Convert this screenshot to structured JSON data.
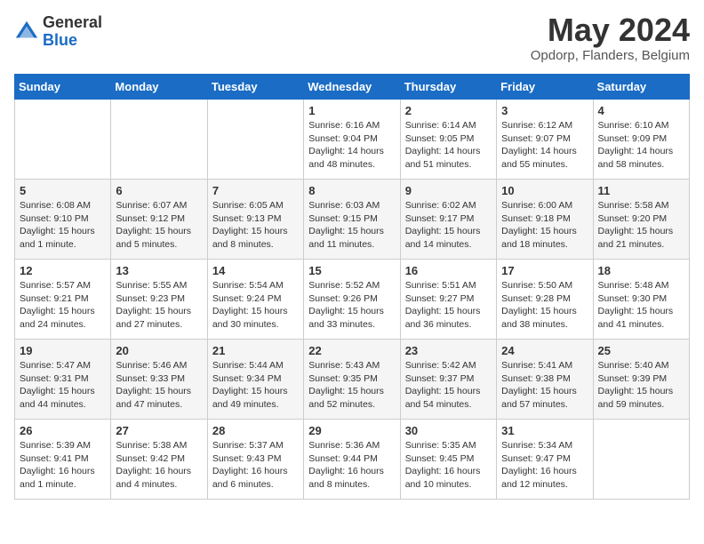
{
  "header": {
    "logo_line1": "General",
    "logo_line2": "Blue",
    "month_title": "May 2024",
    "location": "Opdorp, Flanders, Belgium"
  },
  "days_of_week": [
    "Sunday",
    "Monday",
    "Tuesday",
    "Wednesday",
    "Thursday",
    "Friday",
    "Saturday"
  ],
  "weeks": [
    [
      {
        "day": "",
        "info": ""
      },
      {
        "day": "",
        "info": ""
      },
      {
        "day": "",
        "info": ""
      },
      {
        "day": "1",
        "info": "Sunrise: 6:16 AM\nSunset: 9:04 PM\nDaylight: 14 hours\nand 48 minutes."
      },
      {
        "day": "2",
        "info": "Sunrise: 6:14 AM\nSunset: 9:05 PM\nDaylight: 14 hours\nand 51 minutes."
      },
      {
        "day": "3",
        "info": "Sunrise: 6:12 AM\nSunset: 9:07 PM\nDaylight: 14 hours\nand 55 minutes."
      },
      {
        "day": "4",
        "info": "Sunrise: 6:10 AM\nSunset: 9:09 PM\nDaylight: 14 hours\nand 58 minutes."
      }
    ],
    [
      {
        "day": "5",
        "info": "Sunrise: 6:08 AM\nSunset: 9:10 PM\nDaylight: 15 hours\nand 1 minute."
      },
      {
        "day": "6",
        "info": "Sunrise: 6:07 AM\nSunset: 9:12 PM\nDaylight: 15 hours\nand 5 minutes."
      },
      {
        "day": "7",
        "info": "Sunrise: 6:05 AM\nSunset: 9:13 PM\nDaylight: 15 hours\nand 8 minutes."
      },
      {
        "day": "8",
        "info": "Sunrise: 6:03 AM\nSunset: 9:15 PM\nDaylight: 15 hours\nand 11 minutes."
      },
      {
        "day": "9",
        "info": "Sunrise: 6:02 AM\nSunset: 9:17 PM\nDaylight: 15 hours\nand 14 minutes."
      },
      {
        "day": "10",
        "info": "Sunrise: 6:00 AM\nSunset: 9:18 PM\nDaylight: 15 hours\nand 18 minutes."
      },
      {
        "day": "11",
        "info": "Sunrise: 5:58 AM\nSunset: 9:20 PM\nDaylight: 15 hours\nand 21 minutes."
      }
    ],
    [
      {
        "day": "12",
        "info": "Sunrise: 5:57 AM\nSunset: 9:21 PM\nDaylight: 15 hours\nand 24 minutes."
      },
      {
        "day": "13",
        "info": "Sunrise: 5:55 AM\nSunset: 9:23 PM\nDaylight: 15 hours\nand 27 minutes."
      },
      {
        "day": "14",
        "info": "Sunrise: 5:54 AM\nSunset: 9:24 PM\nDaylight: 15 hours\nand 30 minutes."
      },
      {
        "day": "15",
        "info": "Sunrise: 5:52 AM\nSunset: 9:26 PM\nDaylight: 15 hours\nand 33 minutes."
      },
      {
        "day": "16",
        "info": "Sunrise: 5:51 AM\nSunset: 9:27 PM\nDaylight: 15 hours\nand 36 minutes."
      },
      {
        "day": "17",
        "info": "Sunrise: 5:50 AM\nSunset: 9:28 PM\nDaylight: 15 hours\nand 38 minutes."
      },
      {
        "day": "18",
        "info": "Sunrise: 5:48 AM\nSunset: 9:30 PM\nDaylight: 15 hours\nand 41 minutes."
      }
    ],
    [
      {
        "day": "19",
        "info": "Sunrise: 5:47 AM\nSunset: 9:31 PM\nDaylight: 15 hours\nand 44 minutes."
      },
      {
        "day": "20",
        "info": "Sunrise: 5:46 AM\nSunset: 9:33 PM\nDaylight: 15 hours\nand 47 minutes."
      },
      {
        "day": "21",
        "info": "Sunrise: 5:44 AM\nSunset: 9:34 PM\nDaylight: 15 hours\nand 49 minutes."
      },
      {
        "day": "22",
        "info": "Sunrise: 5:43 AM\nSunset: 9:35 PM\nDaylight: 15 hours\nand 52 minutes."
      },
      {
        "day": "23",
        "info": "Sunrise: 5:42 AM\nSunset: 9:37 PM\nDaylight: 15 hours\nand 54 minutes."
      },
      {
        "day": "24",
        "info": "Sunrise: 5:41 AM\nSunset: 9:38 PM\nDaylight: 15 hours\nand 57 minutes."
      },
      {
        "day": "25",
        "info": "Sunrise: 5:40 AM\nSunset: 9:39 PM\nDaylight: 15 hours\nand 59 minutes."
      }
    ],
    [
      {
        "day": "26",
        "info": "Sunrise: 5:39 AM\nSunset: 9:41 PM\nDaylight: 16 hours\nand 1 minute."
      },
      {
        "day": "27",
        "info": "Sunrise: 5:38 AM\nSunset: 9:42 PM\nDaylight: 16 hours\nand 4 minutes."
      },
      {
        "day": "28",
        "info": "Sunrise: 5:37 AM\nSunset: 9:43 PM\nDaylight: 16 hours\nand 6 minutes."
      },
      {
        "day": "29",
        "info": "Sunrise: 5:36 AM\nSunset: 9:44 PM\nDaylight: 16 hours\nand 8 minutes."
      },
      {
        "day": "30",
        "info": "Sunrise: 5:35 AM\nSunset: 9:45 PM\nDaylight: 16 hours\nand 10 minutes."
      },
      {
        "day": "31",
        "info": "Sunrise: 5:34 AM\nSunset: 9:47 PM\nDaylight: 16 hours\nand 12 minutes."
      },
      {
        "day": "",
        "info": ""
      }
    ]
  ]
}
